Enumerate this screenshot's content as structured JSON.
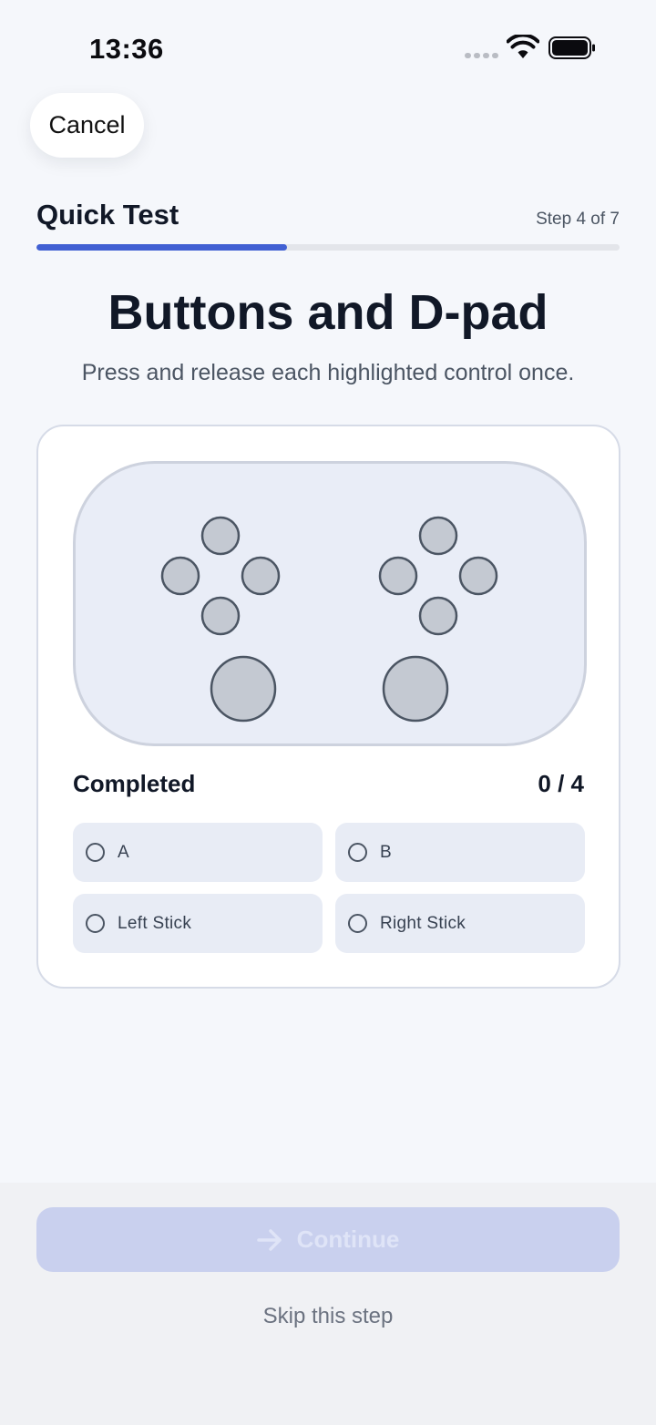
{
  "status_bar": {
    "time": "13:36",
    "icons": [
      "signal-icon",
      "wifi-icon",
      "battery-icon"
    ]
  },
  "nav": {
    "cancel_label": "Cancel"
  },
  "header": {
    "title": "Quick Test",
    "step_label": "Step 4 of 7",
    "progress": 0.43
  },
  "main": {
    "title": "Buttons and D-pad",
    "subtitle": "Press and release each highlighted control once."
  },
  "checklist": {
    "completed_label": "Completed",
    "completed_count": "0 / 4",
    "items": [
      {
        "label": "A",
        "done": false
      },
      {
        "label": "B",
        "done": false
      },
      {
        "label": "Left Stick",
        "done": false
      },
      {
        "label": "Right Stick",
        "done": false
      }
    ]
  },
  "footer": {
    "continue_label": "Continue",
    "continue_icon": "arrow-right-icon",
    "skip_label": "Skip this step"
  },
  "colors": {
    "accent": "#4160d3",
    "background": "#f5f7fb",
    "button_disabled": "#c9d0ee"
  }
}
